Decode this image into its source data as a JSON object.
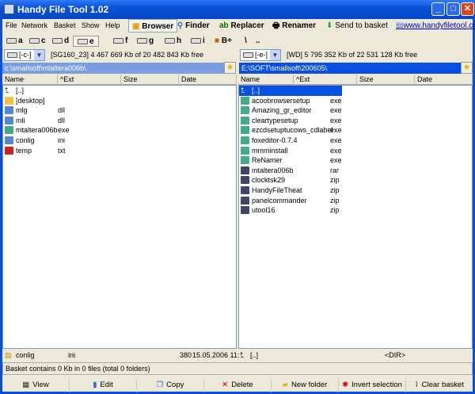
{
  "title": "Handy File Tool 1.02",
  "menu": [
    "File",
    "Network",
    "Basket",
    "Show",
    "Help"
  ],
  "toolbar": {
    "browser": "Browser",
    "finder": "Finder",
    "replacer": "Replacer",
    "renamer": "Renamer",
    "send": "Send to basket",
    "link": "www.handyfiletool.com"
  },
  "drives": [
    "a",
    "c",
    "d",
    "e",
    "f",
    "g",
    "h",
    "i",
    "B+",
    "\\",
    ".."
  ],
  "left": {
    "drive": "[-c-]",
    "info": "[SG160_23] 4 467 669 Kb of 20 482 843 Kb free",
    "path": "c:\\smallsoft\\mtaltera006b\\",
    "files": [
      [
        "[..]",
        ""
      ],
      [
        "[desktop]",
        ""
      ],
      [
        "mlg",
        "dll"
      ],
      [
        "mli",
        "dll"
      ],
      [
        "mtaltera006b",
        "exe"
      ],
      [
        "conlig",
        "ini"
      ],
      [
        "temp",
        "txt"
      ]
    ]
  },
  "right": {
    "drive": "[-e-]",
    "info": "[WD] 5 795 352 Kb of 22 531 128 Kb free",
    "path": "E:\\SOFT\\smallsoft\\200605\\",
    "files": [
      [
        "[..]",
        ""
      ],
      [
        "acoobrowsersetup",
        "exe"
      ],
      [
        "Amazing_gr_editor",
        "exe"
      ],
      [
        "cleartypesetup",
        "exe"
      ],
      [
        "ezcdsetuptucows_cdlabel",
        "exe"
      ],
      [
        "foxeditor-0.7.4",
        "exe"
      ],
      [
        "mmminstall",
        "exe"
      ],
      [
        "ReNamer",
        "exe"
      ],
      [
        "mtaltera006b",
        "rar"
      ],
      [
        "clocktsk29",
        "zip"
      ],
      [
        "HandyFileTheat",
        "zip"
      ],
      [
        "panelcommander",
        "zip"
      ],
      [
        "utool16",
        "zip"
      ]
    ]
  },
  "columns": {
    "name": "Name",
    "ext": "Ext",
    "size": "Size",
    "date": "Date"
  },
  "status": {
    "name": "conlig",
    "ext": "ini",
    "size": "380",
    "date": "15.05.2006 11:",
    "rname": "[..]",
    "rsize": "<DIR>"
  },
  "basket": "Basket contains 0 Kb in 0 files (total 0 folders)",
  "buttons": [
    "View",
    "Edit",
    "Copy",
    "Delete",
    "New folder",
    "Invert selection",
    "Clear basket"
  ]
}
